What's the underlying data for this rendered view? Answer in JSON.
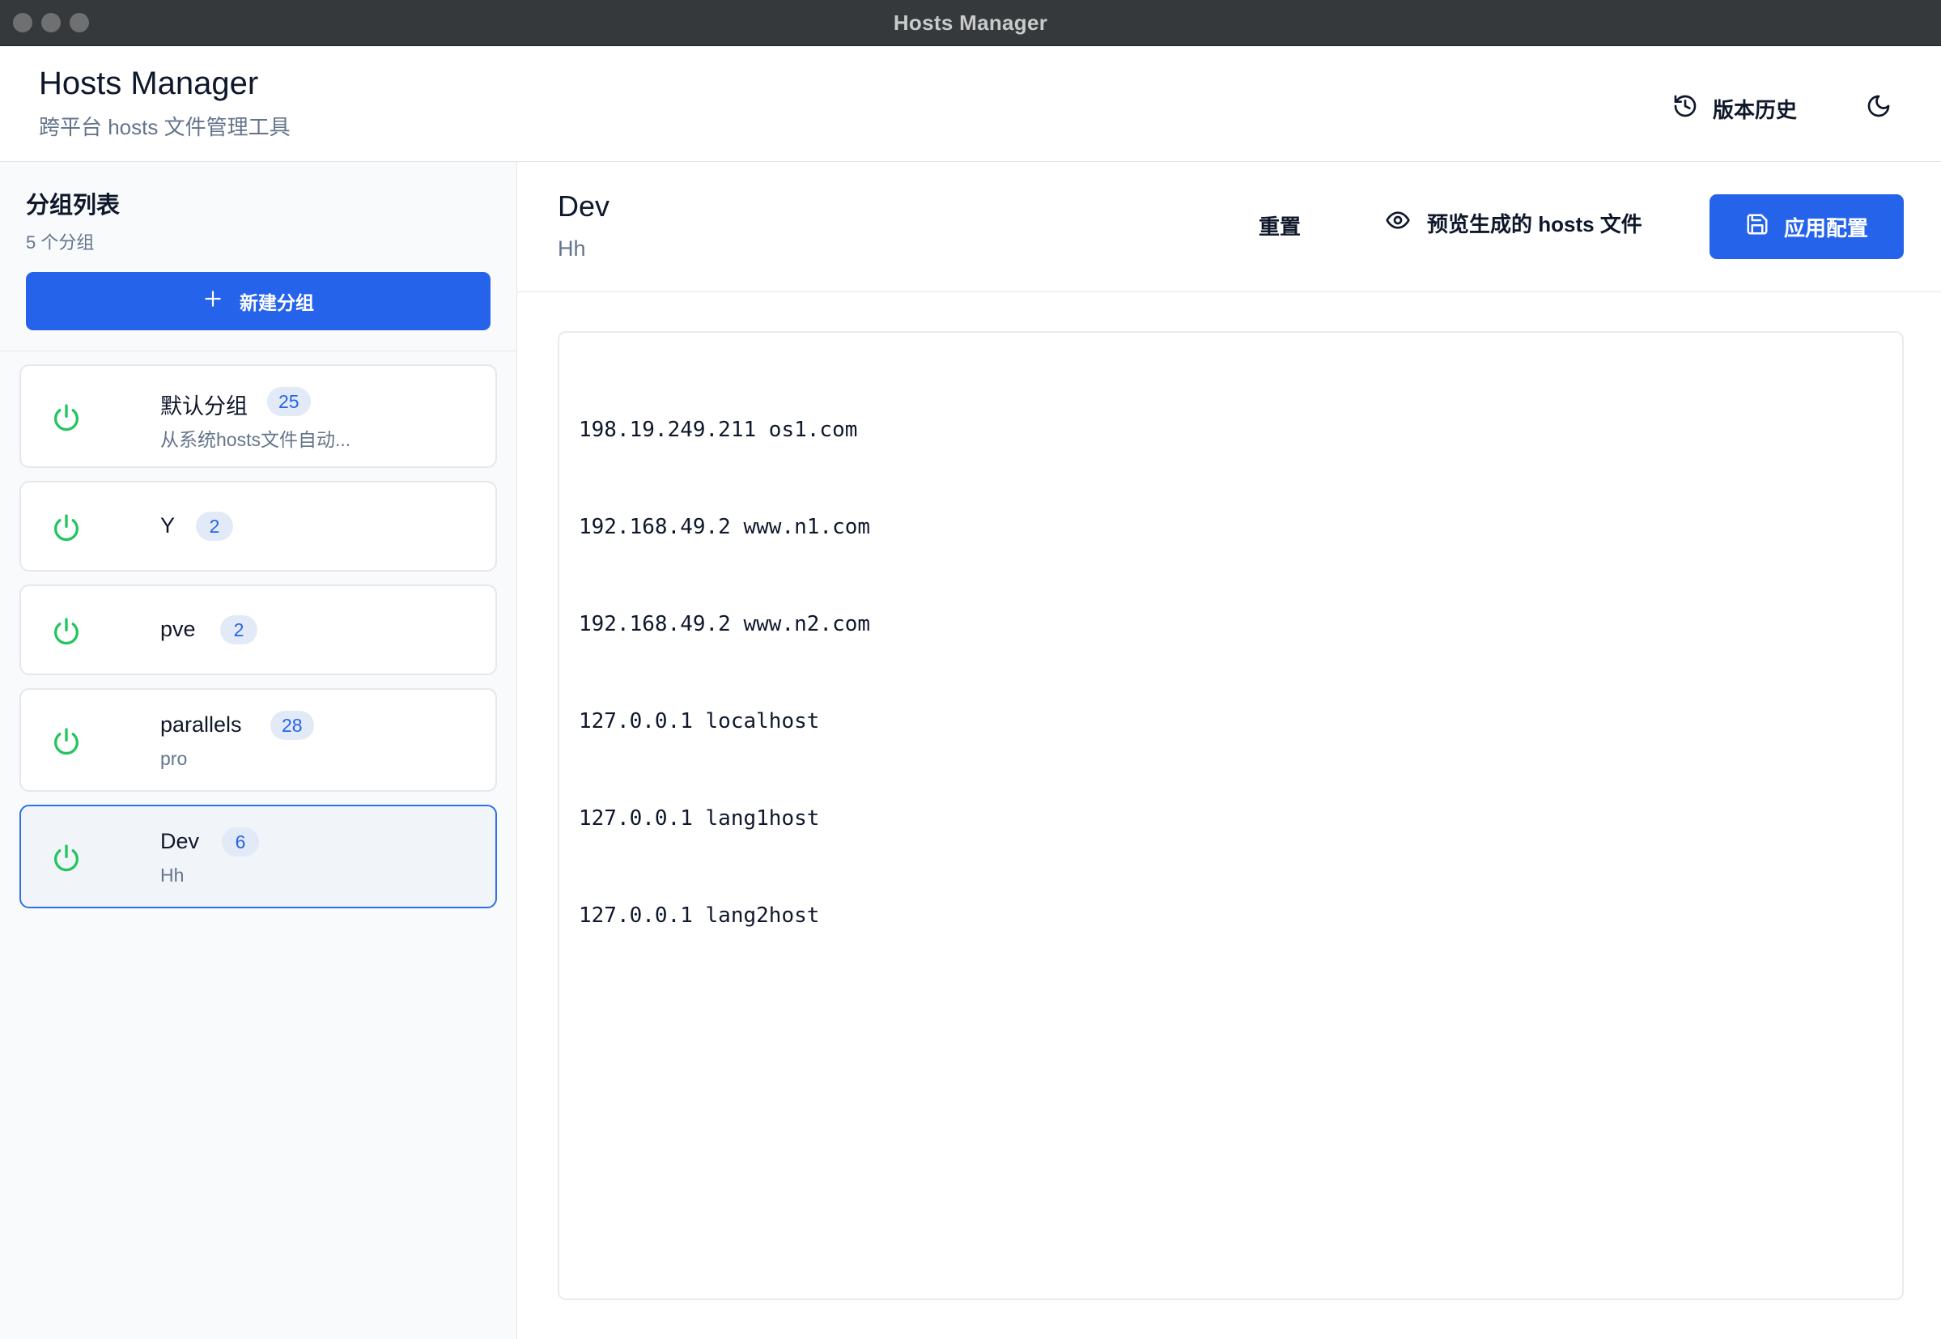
{
  "window": {
    "title": "Hosts Manager"
  },
  "header": {
    "title": "Hosts Manager",
    "subtitle": "跨平台 hosts 文件管理工具",
    "history_label": "版本历史"
  },
  "sidebar": {
    "title": "分组列表",
    "count": "5 个分组",
    "new_group_label": "新建分组",
    "groups": [
      {
        "name": "默认分组",
        "count": "25",
        "desc": "从系统hosts文件自动...",
        "enabled": true
      },
      {
        "name": "Y",
        "count": "2",
        "desc": "",
        "enabled": true
      },
      {
        "name": "pve",
        "count": "2",
        "desc": "",
        "enabled": true
      },
      {
        "name": "parallels",
        "count": "28",
        "desc": "pro",
        "enabled": true
      },
      {
        "name": "Dev",
        "count": "6",
        "desc": "Hh",
        "enabled": true,
        "selected": true
      }
    ]
  },
  "main": {
    "title": "Dev",
    "subtitle": "Hh",
    "reset_label": "重置",
    "preview_label": "预览生成的 hosts 文件",
    "apply_label": "应用配置",
    "editor_lines": [
      "198.19.249.211 os1.com",
      "192.168.49.2 www.n1.com",
      "192.168.49.2 www.n2.com",
      "127.0.0.1 localhost",
      "127.0.0.1 lang1host",
      "127.0.0.1 lang2host"
    ]
  },
  "colors": {
    "accent": "#2563eb",
    "power_on": "#22c55e",
    "titlebar": "#36393b",
    "muted_text": "#64748b"
  },
  "icons": {
    "history": "history-icon",
    "theme": "moon-icon",
    "new_group": "plus-icon",
    "power": "power-icon",
    "preview": "eye-icon",
    "apply": "save-icon"
  }
}
